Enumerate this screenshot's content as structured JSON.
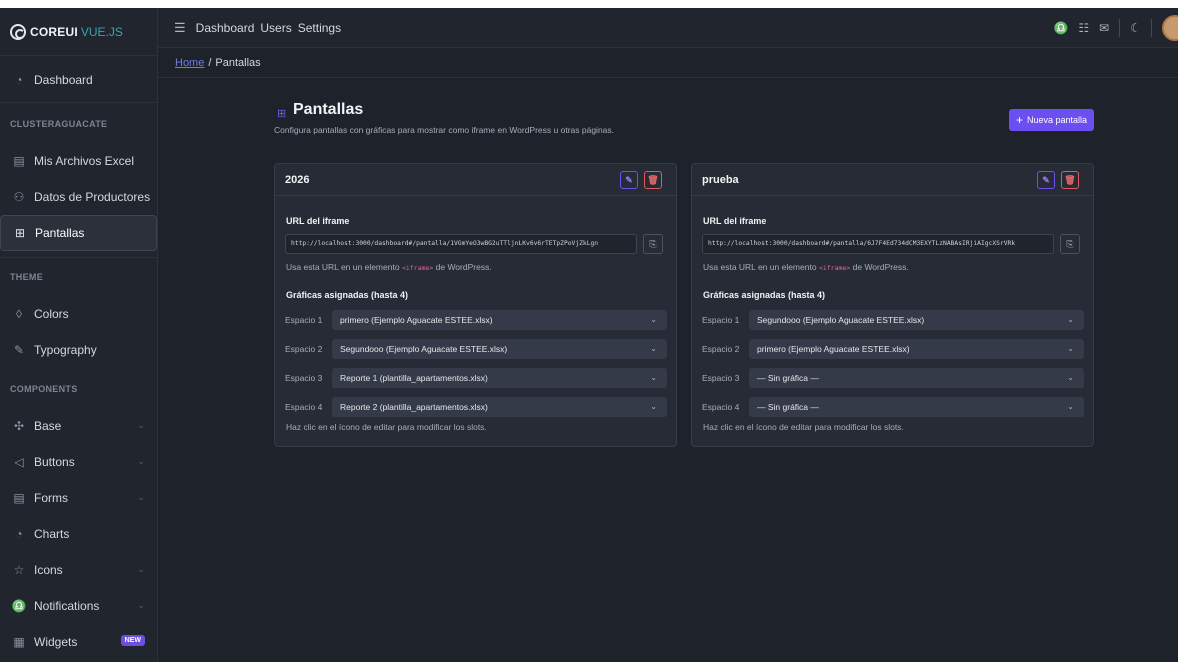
{
  "brand": {
    "name": "COREUI",
    "sub": "VUE.JS"
  },
  "sidebar": {
    "dashboard": "Dashboard",
    "section1": "CLUSTERAGUACATE",
    "items1": [
      {
        "label": "Mis Archivos Excel",
        "icon": "table-icon"
      },
      {
        "label": "Datos de Productores",
        "icon": "users-icon"
      },
      {
        "label": "Pantallas",
        "icon": "grid-icon"
      }
    ],
    "section2": "THEME",
    "items2": [
      {
        "label": "Colors",
        "icon": "drop-icon"
      },
      {
        "label": "Typography",
        "icon": "pencil-icon"
      }
    ],
    "section3": "COMPONENTS",
    "items3": [
      {
        "label": "Base",
        "icon": "puzzle-icon"
      },
      {
        "label": "Buttons",
        "icon": "cursor-icon"
      },
      {
        "label": "Forms",
        "icon": "notes-icon"
      },
      {
        "label": "Charts",
        "icon": "chart-pie-icon"
      },
      {
        "label": "Icons",
        "icon": "star-icon"
      },
      {
        "label": "Notifications",
        "icon": "bell-icon"
      },
      {
        "label": "Widgets",
        "icon": "calculator-icon",
        "badge": "NEW"
      }
    ]
  },
  "header": {
    "links": [
      "Dashboard",
      "Users",
      "Settings"
    ]
  },
  "breadcrumb": {
    "home": "Home",
    "current": "Pantallas"
  },
  "page": {
    "title": "Pantallas",
    "subtitle": "Configura pantallas con gráficas para mostrar como iframe en WordPress u otras páginas.",
    "new_button": "Nueva pantalla"
  },
  "cards": [
    {
      "title": "2026",
      "url_label": "URL del iframe",
      "url": "http://localhost:3000/dashboard#/pantalla/1VGmYeO3wBG2uTTljnLKv6v6rTETpZPoVjZkLgn",
      "hint_pre": "Usa esta URL en un elemento",
      "hint_code": "<iframe>",
      "hint_post": "de WordPress.",
      "slots_label": "Gráficas asignadas (hasta 4)",
      "slots": [
        {
          "name": "Espacio 1",
          "value": "primero (Ejemplo Aguacate ESTEE.xlsx)"
        },
        {
          "name": "Espacio 2",
          "value": "Segundooo (Ejemplo Aguacate ESTEE.xlsx)"
        },
        {
          "name": "Espacio 3",
          "value": "Reporte 1 (plantilla_apartamentos.xlsx)"
        },
        {
          "name": "Espacio 4",
          "value": "Reporte 2 (plantilla_apartamentos.xlsx)"
        }
      ],
      "footer": "Haz clic en el ícono de editar para modificar los slots."
    },
    {
      "title": "prueba",
      "url_label": "URL del iframe",
      "url": "http://localhost:3000/dashboard#/pantalla/6J7F4Ed734dCM3EXYTLzNABAsIRjiAIgcXSrVRk",
      "hint_pre": "Usa esta URL en un elemento",
      "hint_code": "<iframe>",
      "hint_post": "de WordPress.",
      "slots_label": "Gráficas asignadas (hasta 4)",
      "slots": [
        {
          "name": "Espacio 1",
          "value": "Segundooo (Ejemplo Aguacate ESTEE.xlsx)"
        },
        {
          "name": "Espacio 2",
          "value": "primero (Ejemplo Aguacate ESTEE.xlsx)"
        },
        {
          "name": "Espacio 3",
          "value": "— Sin gráfica —"
        },
        {
          "name": "Espacio 4",
          "value": "— Sin gráfica —"
        }
      ],
      "footer": "Haz clic en el ícono de editar para modificar los slots."
    }
  ],
  "colors": {
    "accent": "#6b4ff0",
    "danger": "#e05a5a",
    "background": "#1d222b",
    "card": "#262b35"
  }
}
